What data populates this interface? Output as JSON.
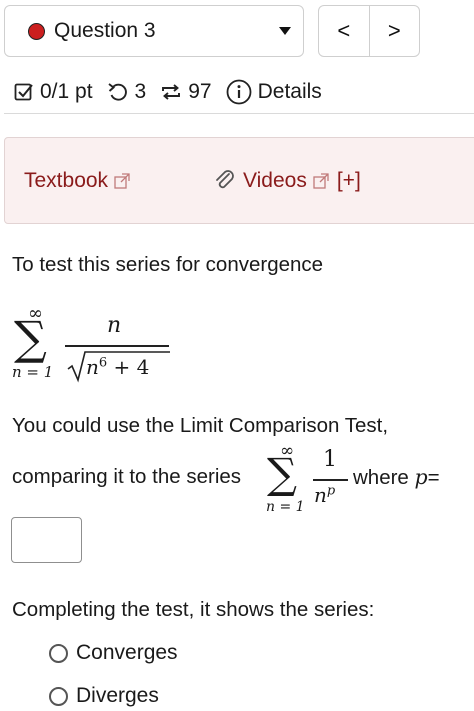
{
  "header": {
    "question_label": "Question 3",
    "prev_label": "<",
    "next_label": ">"
  },
  "stats": {
    "score": "0/1 pt",
    "retries": "3",
    "submissions": "97",
    "details": "Details"
  },
  "resources": {
    "textbook": "Textbook",
    "videos": "Videos",
    "expand": "[+]"
  },
  "problem": {
    "intro": "To test this series for convergence",
    "sum_upper": "∞",
    "sum_symbol": "∑",
    "sum_lower": "n = 1",
    "numerator": "n",
    "radicand_base": "n",
    "radicand_exp": "6",
    "radicand_rest": " + 4",
    "limit_line": "You could use the Limit Comparison Test,",
    "compare_text": "comparing it to the series",
    "cmp_upper": "∞",
    "cmp_symbol": "∑",
    "cmp_lower": "n = 1",
    "cmp_num": "1",
    "cmp_den_base": "n",
    "cmp_den_exp": "p",
    "where_text": "where",
    "where_var": "p",
    "where_eq": "=",
    "answer_value": "",
    "completing": "Completing the test, it shows the series:",
    "options": [
      "Converges",
      "Diverges"
    ]
  },
  "colors": {
    "status_dot": "#cc1f1f",
    "link": "#8a1b1b",
    "resource_bg": "#faf0f0"
  }
}
